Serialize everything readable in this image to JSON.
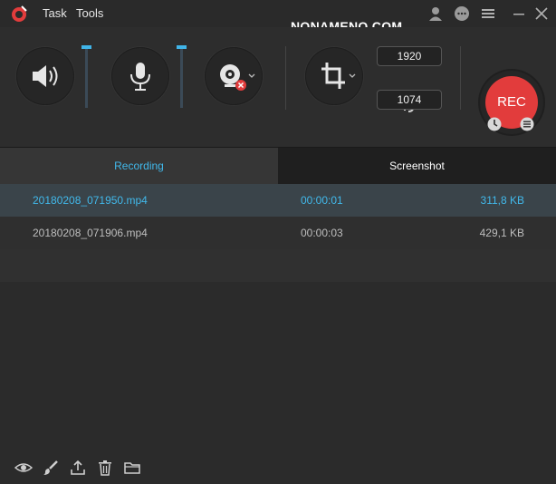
{
  "menu": {
    "task": "Task",
    "tools": "Tools"
  },
  "watermark": "NONAMENO.COM",
  "titlebar_icons": [
    "user-icon",
    "chat-icon",
    "menu-icon",
    "minimize-icon",
    "close-icon"
  ],
  "toolbar": {
    "system_sound_icon": "speaker-icon",
    "microphone_icon": "microphone-icon",
    "webcam_icon": "webcam-icon",
    "region_icon": "crop-icon",
    "system_sound_level": 1.0,
    "microphone_level": 1.0,
    "width": "1920",
    "height": "1074",
    "rec_label": "REC",
    "accent_color": "#40b4e8",
    "rec_color": "#e23c3c"
  },
  "tabs": {
    "recording": "Recording",
    "screenshot": "Screenshot"
  },
  "files": [
    {
      "name": "20180208_071950.mp4",
      "duration": "00:00:01",
      "size": "311,8 KB",
      "selected": true
    },
    {
      "name": "20180208_071906.mp4",
      "duration": "00:00:03",
      "size": "429,1 KB",
      "selected": false
    }
  ],
  "bottom_icons": [
    "eye-icon",
    "brush-icon",
    "share-icon",
    "trash-icon",
    "folder-icon"
  ]
}
